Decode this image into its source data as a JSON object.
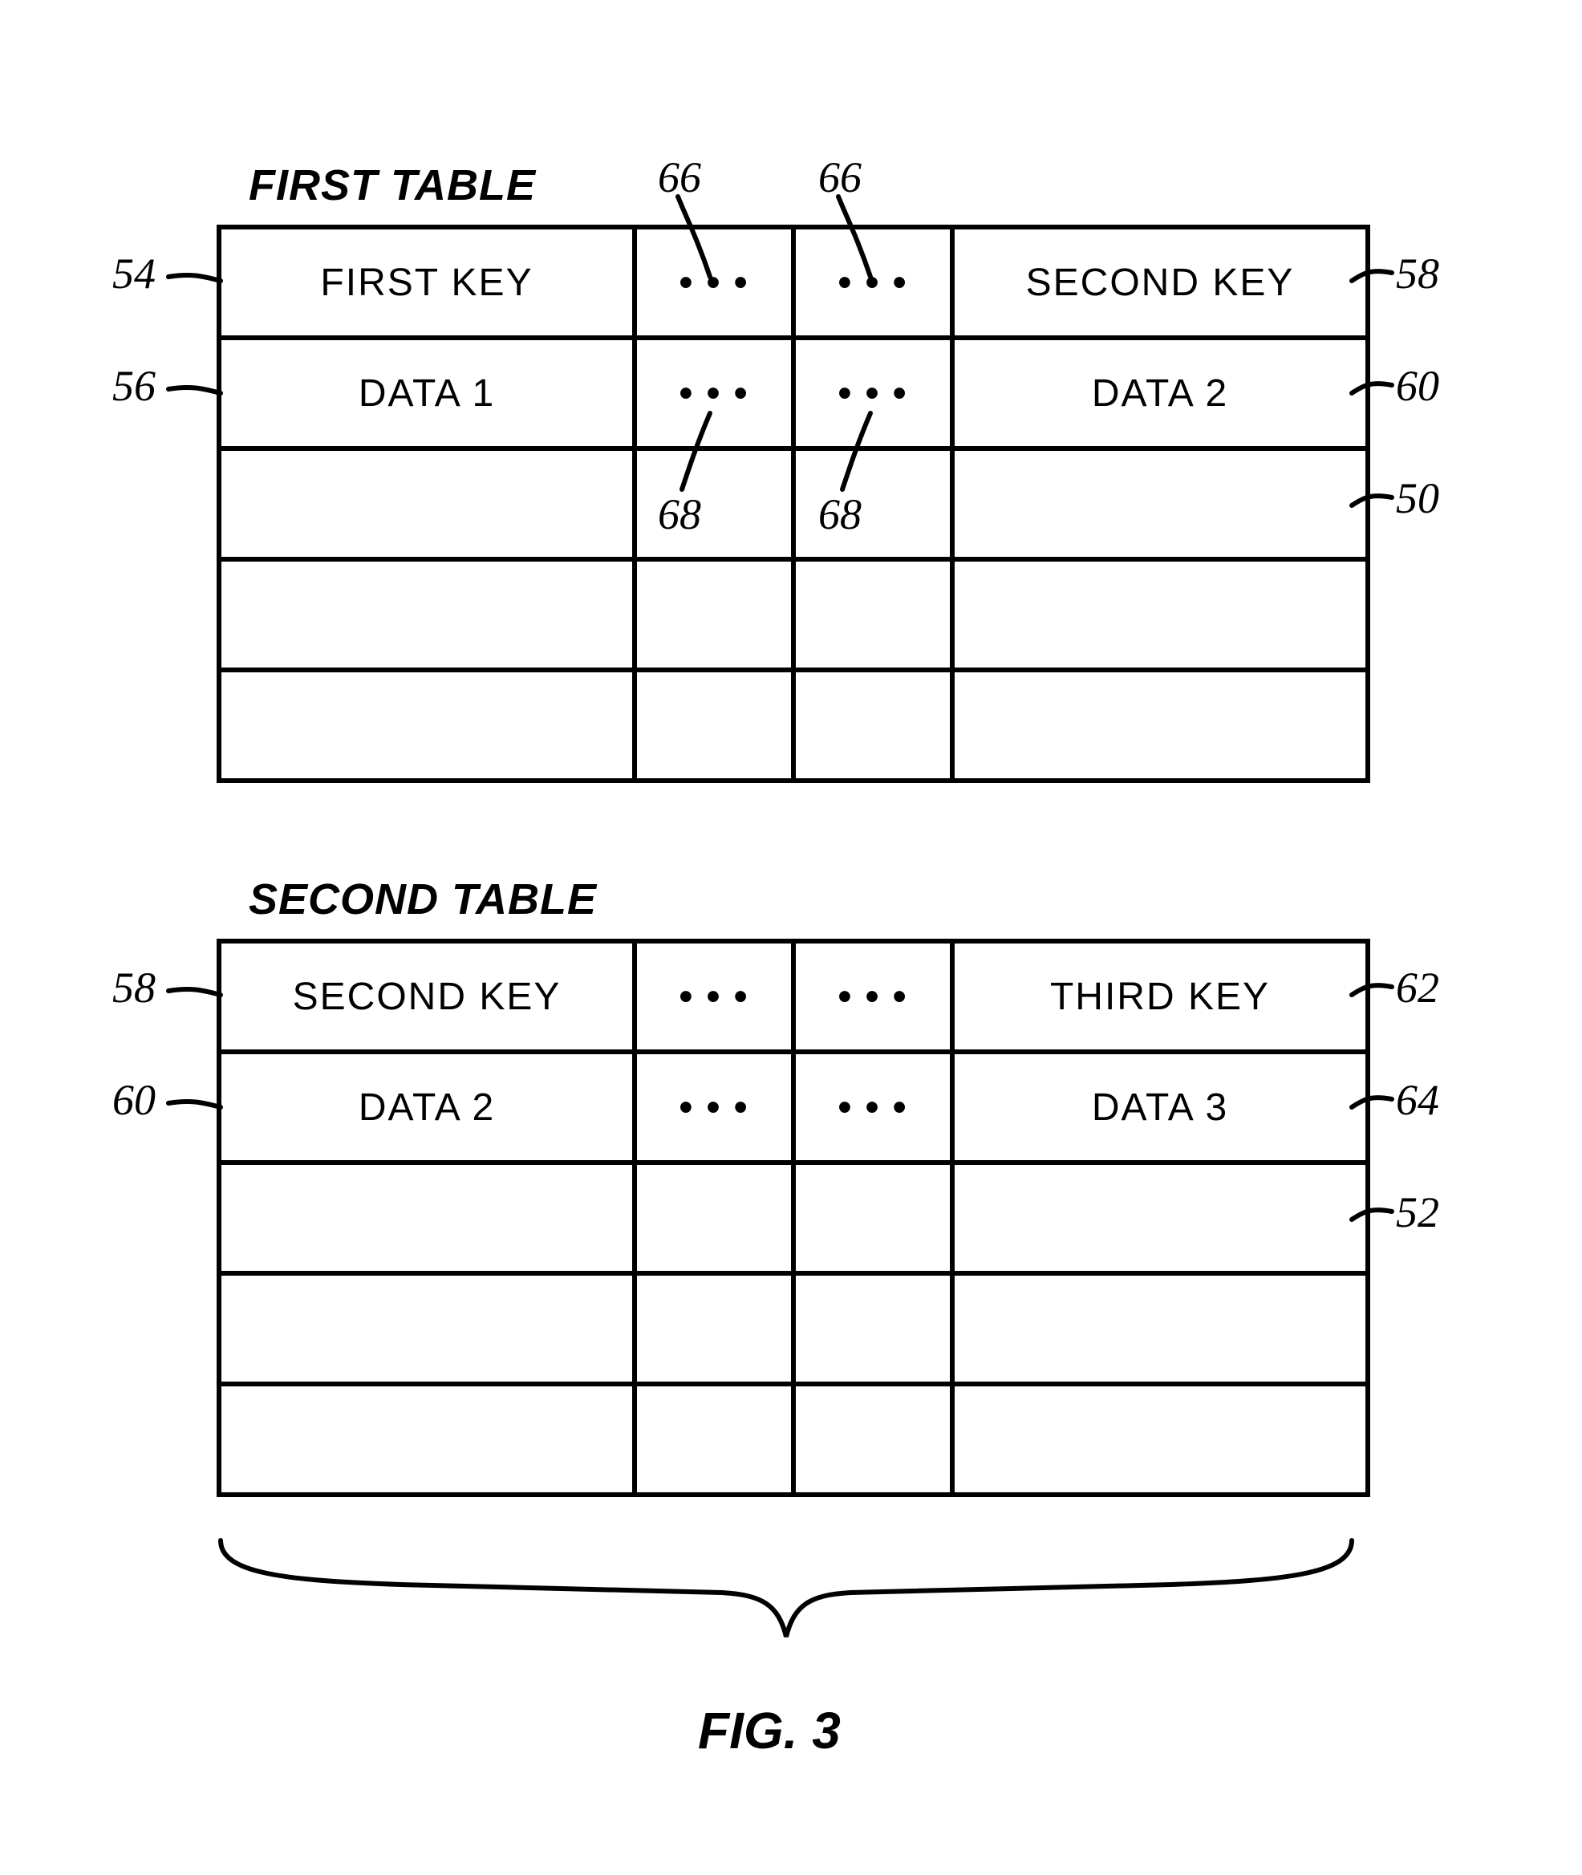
{
  "fig_label": "FIG. 3",
  "tables": [
    {
      "title": "FIRST TABLE",
      "rows": [
        [
          "FIRST KEY",
          "• • •",
          "• • •",
          "SECOND KEY"
        ],
        [
          "DATA 1",
          "• • •",
          "• • •",
          "DATA 2"
        ],
        [
          "",
          "",
          "",
          ""
        ],
        [
          "",
          "",
          "",
          ""
        ],
        [
          "",
          "",
          "",
          ""
        ]
      ]
    },
    {
      "title": "SECOND TABLE",
      "rows": [
        [
          "SECOND KEY",
          "• • •",
          "• • •",
          "THIRD KEY"
        ],
        [
          "DATA 2",
          "• • •",
          "• • •",
          "DATA 3"
        ],
        [
          "",
          "",
          "",
          ""
        ],
        [
          "",
          "",
          "",
          ""
        ],
        [
          "",
          "",
          "",
          ""
        ]
      ]
    }
  ],
  "refs": {
    "r54": "54",
    "r56": "56",
    "r58a": "58",
    "r58b": "58",
    "r60a": "60",
    "r60b": "60",
    "r50": "50",
    "r62": "62",
    "r64": "64",
    "r52": "52",
    "r66a": "66",
    "r66b": "66",
    "r68a": "68",
    "r68b": "68"
  }
}
